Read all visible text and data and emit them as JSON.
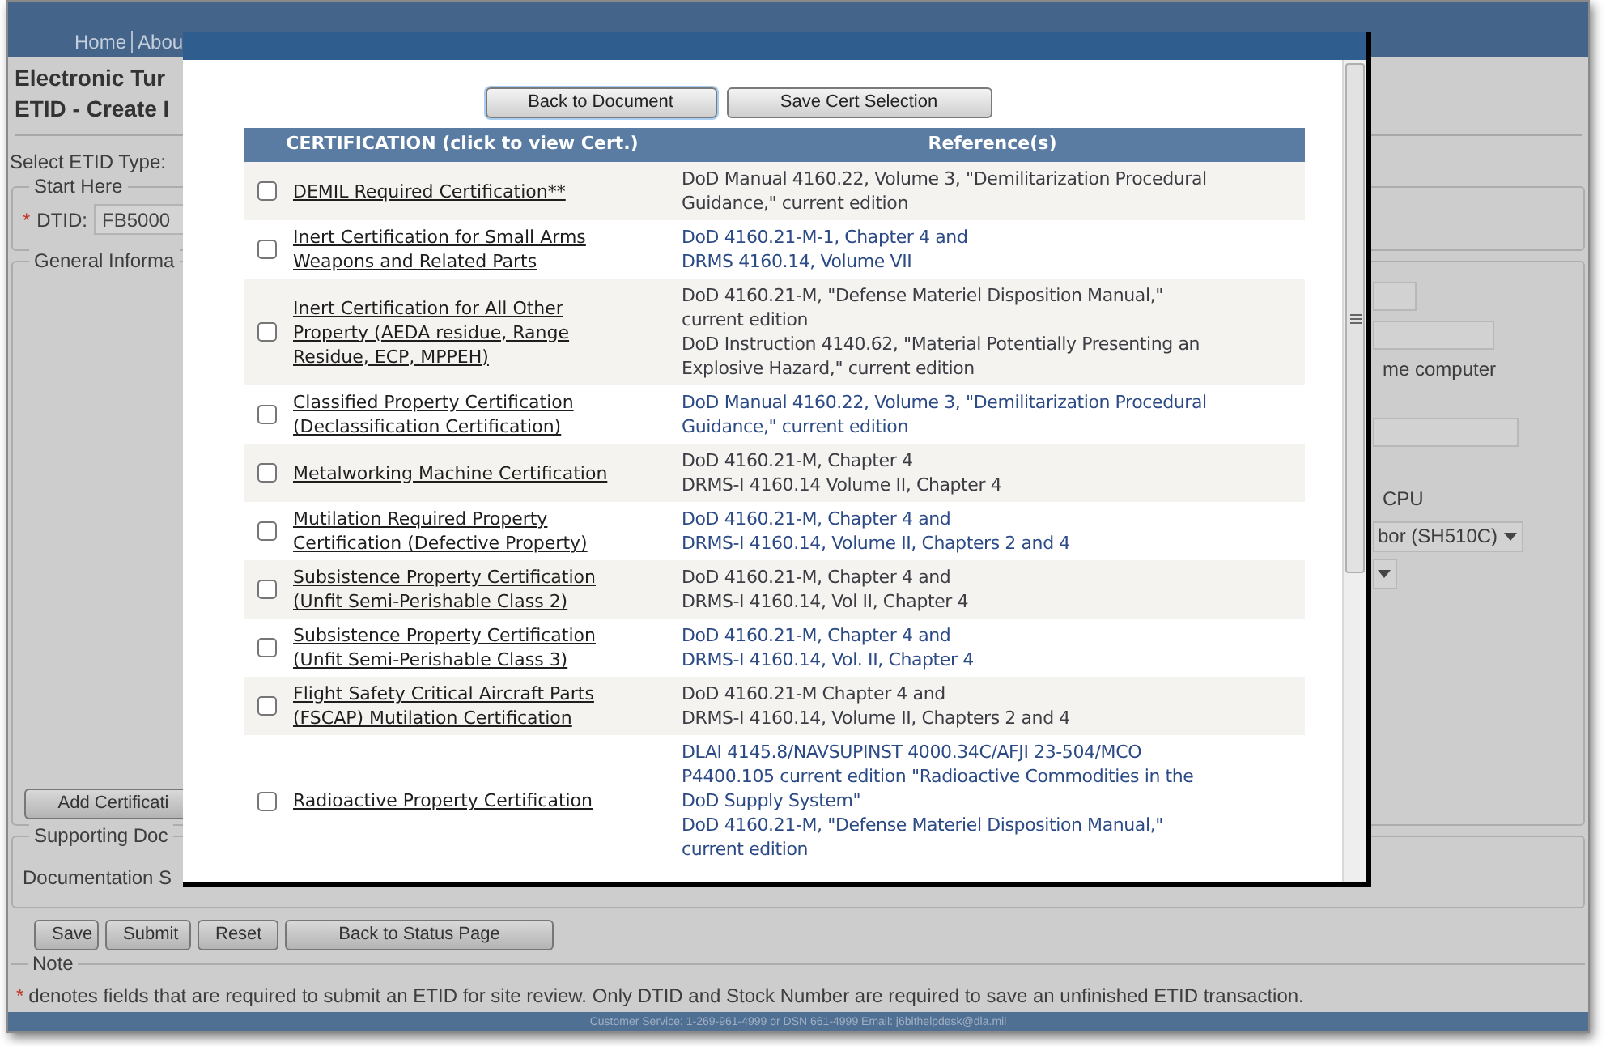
{
  "header": {
    "nav": [
      "Home",
      "Abou"
    ]
  },
  "page": {
    "title_lines": [
      "Electronic Tur",
      "ETID - Create I"
    ],
    "etid_type_label": "Select ETID Type:",
    "start_here": {
      "legend": "Start Here",
      "required_mark": "*",
      "label": "DTID:",
      "value": "FB5000"
    },
    "general_information": {
      "legend": "General Informa",
      "add_button": "Add Certificati",
      "right_fragments": [
        {
          "kind": "input"
        },
        {
          "kind": "input"
        },
        {
          "kind": "text",
          "text": "me computer"
        },
        {
          "kind": "input"
        },
        {
          "kind": "text",
          "text": "CPU"
        },
        {
          "kind": "select",
          "value": "bor (SH510C)"
        },
        {
          "kind": "select"
        }
      ]
    },
    "supporting_documents": {
      "legend": "Supporting Doc",
      "label": "Documentation S"
    },
    "buttons": [
      "Save",
      "Submit",
      "Reset",
      "Back to Status Page"
    ],
    "note": {
      "legend": "Note",
      "required_mark": "*",
      "text": "denotes fields that are required to submit an ETID for site review. Only DTID and Stock Number are required to save an unfinished ETID transaction."
    }
  },
  "footer": "Customer Service: 1-269-961-4999 or DSN 661-4999 Email: j6bithelpdesk@dla.mil",
  "modal": {
    "buttons": [
      "Back to Document",
      "Save Cert Selection"
    ],
    "columns": [
      "CERTIFICATION (click to view Cert.)",
      "Reference(s)"
    ],
    "rows": [
      {
        "checked": false,
        "certification": [
          "DEMIL Required Certification**"
        ],
        "references": [
          [
            "DoD Manual 4160.22, Volume 3, \"Demilitarization Procedural",
            "Guidance,\" current edition"
          ]
        ]
      },
      {
        "checked": false,
        "certification": [
          "Inert Certification for Small Arms",
          "Weapons and Related Parts"
        ],
        "references": [
          [
            "DoD 4160.21-M-1, Chapter 4 and",
            "DRMS 4160.14, Volume VII"
          ]
        ]
      },
      {
        "checked": false,
        "certification": [
          "Inert Certification for All Other",
          "Property (AEDA residue, Range",
          "Residue, ECP, MPPEH)"
        ],
        "references": [
          [
            "DoD 4160.21-M, \"Defense Materiel Disposition Manual,\"",
            "current edition"
          ],
          [
            "DoD Instruction 4140.62, \"Material Potentially Presenting an",
            "Explosive Hazard,\" current edition"
          ]
        ]
      },
      {
        "checked": false,
        "certification": [
          "Classified Property Certification",
          "(Declassification Certification)"
        ],
        "references": [
          [
            "DoD Manual 4160.22, Volume 3, \"Demilitarization Procedural",
            "Guidance,\" current edition"
          ]
        ]
      },
      {
        "checked": false,
        "certification": [
          "Metalworking Machine Certification"
        ],
        "references": [
          [
            "DoD 4160.21-M, Chapter 4",
            "DRMS-I 4160.14 Volume II, Chapter 4"
          ]
        ]
      },
      {
        "checked": false,
        "certification": [
          "Mutilation Required Property",
          "Certification (Defective Property)"
        ],
        "references": [
          [
            "DoD 4160.21-M, Chapter 4 and",
            "DRMS-I 4160.14, Volume II, Chapters 2 and 4"
          ]
        ]
      },
      {
        "checked": false,
        "certification": [
          "Subsistence Property Certification",
          "(Unfit Semi-Perishable Class 2)"
        ],
        "references": [
          [
            "DoD 4160.21-M, Chapter 4 and",
            "DRMS-I 4160.14, Vol II, Chapter 4"
          ]
        ]
      },
      {
        "checked": false,
        "certification": [
          "Subsistence Property Certification",
          "(Unfit Semi-Perishable Class 3)"
        ],
        "references": [
          [
            "DoD 4160.21-M, Chapter 4 and",
            "DRMS-I 4160.14, Vol. II, Chapter 4"
          ]
        ]
      },
      {
        "checked": false,
        "certification": [
          "Flight Safety Critical Aircraft Parts",
          "(FSCAP) Mutilation Certification"
        ],
        "references": [
          [
            "DoD 4160.21-M Chapter 4 and",
            "DRMS-I 4160.14, Volume II, Chapters 2 and 4"
          ]
        ]
      },
      {
        "checked": false,
        "certification": [
          "Radioactive Property Certification"
        ],
        "references": [
          [
            "DLAI 4145.8/NAVSUPINST 4000.34C/AFJI 23-504/MCO",
            "P4400.105 current edition \"Radioactive Commodities in the",
            "DoD Supply System\""
          ],
          [
            "DoD 4160.21-M, \"Defense Materiel Disposition Manual,\"",
            "current edition"
          ]
        ]
      }
    ]
  }
}
